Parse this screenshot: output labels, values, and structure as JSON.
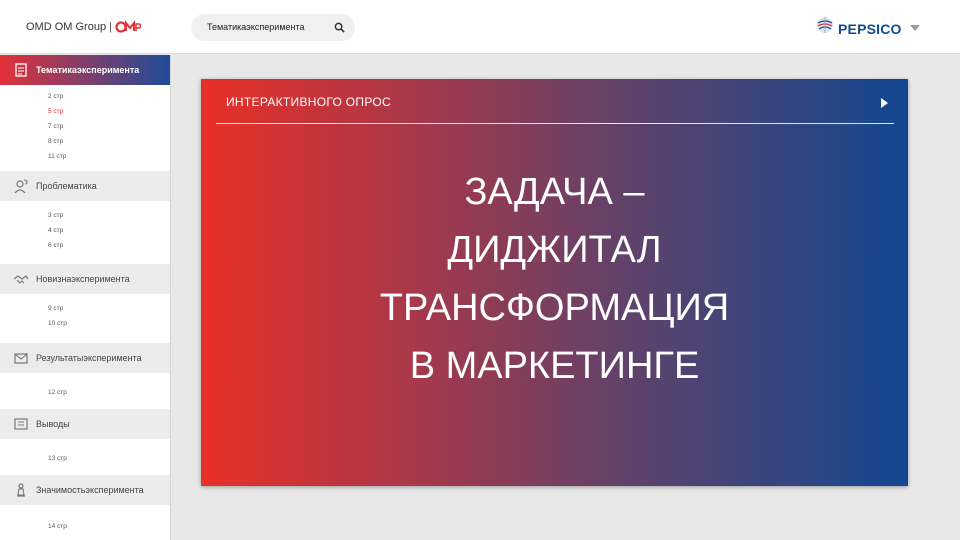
{
  "header": {
    "brand": "OMD OM Group",
    "brand_separator": "|",
    "search_value": "Тематикаэксперимента",
    "partner_logo_text": "PEPSICO",
    "icons": [
      "omd-mark-icon",
      "search-icon",
      "pepsico-globe-icon",
      "chevron-down-icon"
    ]
  },
  "sidebar": {
    "sections": [
      {
        "label": "Тематикаэксперимента",
        "icon": "document-icon",
        "active": true,
        "items": [
          "2 стр",
          "5 стр",
          "7 стр",
          "8 стр",
          "11 стр"
        ]
      },
      {
        "label": "Проблематика",
        "icon": "question-person-icon",
        "active": false,
        "items": [
          "3 стр",
          "4 стр",
          "6 стр"
        ]
      },
      {
        "label": "Новизнаэксперимента",
        "icon": "handshake-icon",
        "active": false,
        "items": [
          "9 стр",
          "10 стр"
        ]
      },
      {
        "label": "Результатыэксперимента",
        "icon": "envelope-icon",
        "active": false,
        "items": [
          "12 стр"
        ]
      },
      {
        "label": "Выводы",
        "icon": "calculator-icon",
        "active": false,
        "items": [
          "13 стр"
        ]
      },
      {
        "label": "Значимостьэксперимента",
        "icon": "chess-piece-icon",
        "active": false,
        "items": [
          "14 стр"
        ]
      }
    ],
    "current_item": "5 стр"
  },
  "slide": {
    "top_label": "ИНТЕРАКТИВНОГО ОПРОС",
    "headline_lines": [
      "ЗАДАЧА –",
      "ДИДЖИТАЛ",
      "ТРАНСФОРМАЦИЯ",
      "В МАРКЕТИНГЕ"
    ],
    "icons": [
      "play-icon"
    ]
  },
  "colors": {
    "accent_red": "#e2323a",
    "accent_blue": "#1f4b9a",
    "pepsico_blue": "#104b8f"
  }
}
